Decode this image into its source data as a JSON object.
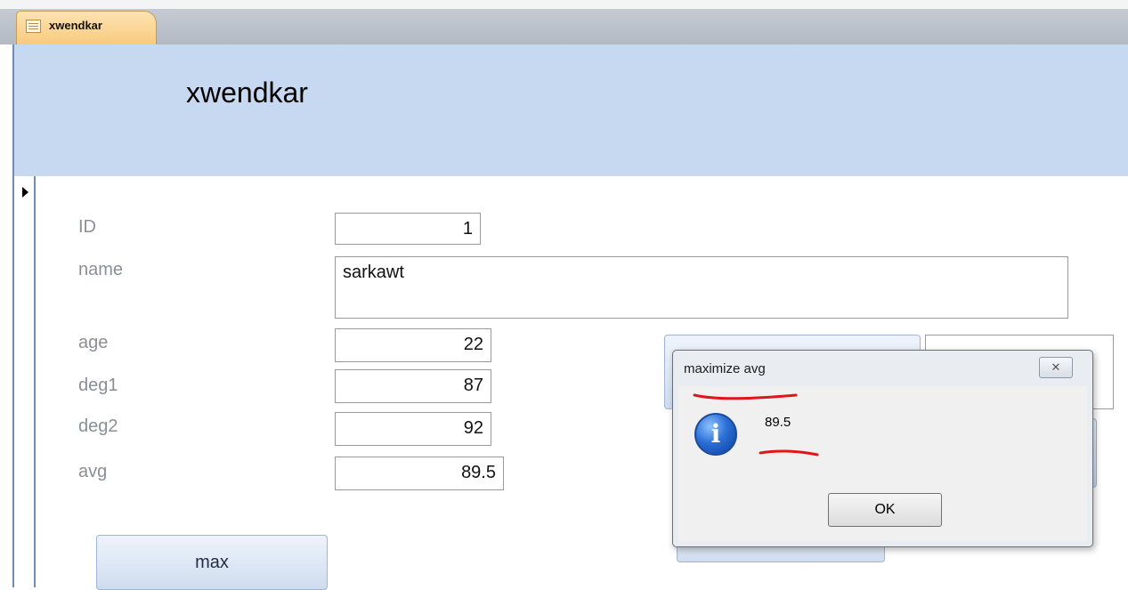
{
  "tab": {
    "icon": "form-icon",
    "label": "xwendkar"
  },
  "form": {
    "title": "xwendkar",
    "fields": {
      "id": {
        "label": "ID",
        "value": "1"
      },
      "name": {
        "label": "name",
        "value": "sarkawt"
      },
      "age": {
        "label": "age",
        "value": "22"
      },
      "deg1": {
        "label": "deg1",
        "value": "87"
      },
      "deg2": {
        "label": "deg2",
        "value": "92"
      },
      "avg": {
        "label": "avg",
        "value": "89.5"
      }
    },
    "max_button_label": "max"
  },
  "dialog": {
    "title": "maximize avg",
    "close_glyph": "✕",
    "icon": "info-icon",
    "message": "89.5",
    "ok_label": "OK"
  },
  "annotation_color": "#e0161c"
}
